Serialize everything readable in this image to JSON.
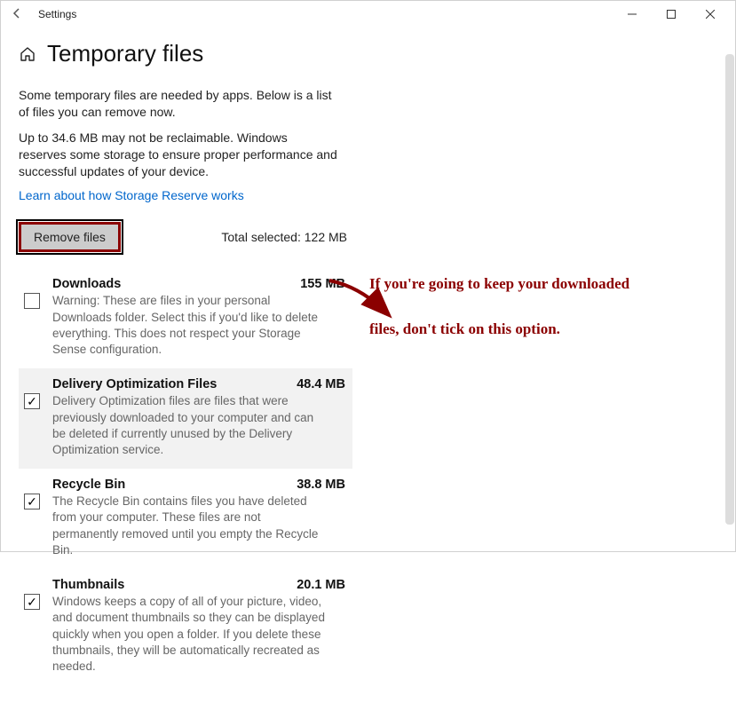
{
  "titlebar": {
    "app_name": "Settings"
  },
  "header": {
    "title": "Temporary files"
  },
  "intro": {
    "p1": "Some temporary files are needed by apps. Below is a list of files you can remove now.",
    "p2": "Up to 34.6 MB may not be reclaimable. Windows reserves some storage to ensure proper performance and successful updates of your device.",
    "link": "Learn about how Storage Reserve works"
  },
  "actions": {
    "remove_label": "Remove files",
    "total_label": "Total selected: 122 MB"
  },
  "items": [
    {
      "title": "Downloads",
      "size": "155 MB",
      "desc": "Warning: These are files in your personal Downloads folder. Select this if you'd like to delete everything. This does not respect your Storage Sense configuration.",
      "checked": false
    },
    {
      "title": "Delivery Optimization Files",
      "size": "48.4 MB",
      "desc": "Delivery Optimization files are files that were previously downloaded to your computer and can be deleted if currently unused by the Delivery Optimization service.",
      "checked": true
    },
    {
      "title": "Recycle Bin",
      "size": "38.8 MB",
      "desc": "The Recycle Bin contains files you have deleted from your computer. These files are not permanently removed until you empty the Recycle Bin.",
      "checked": true
    },
    {
      "title": "Thumbnails",
      "size": "20.1 MB",
      "desc": "Windows keeps a copy of all of your picture, video, and document thumbnails so they can be displayed quickly when you open a folder. If you delete these thumbnails, they will be automatically recreated as needed.",
      "checked": true
    }
  ],
  "annotation": {
    "line1": "If you're going to keep your downloaded",
    "line2": "files, don't tick on this option."
  }
}
